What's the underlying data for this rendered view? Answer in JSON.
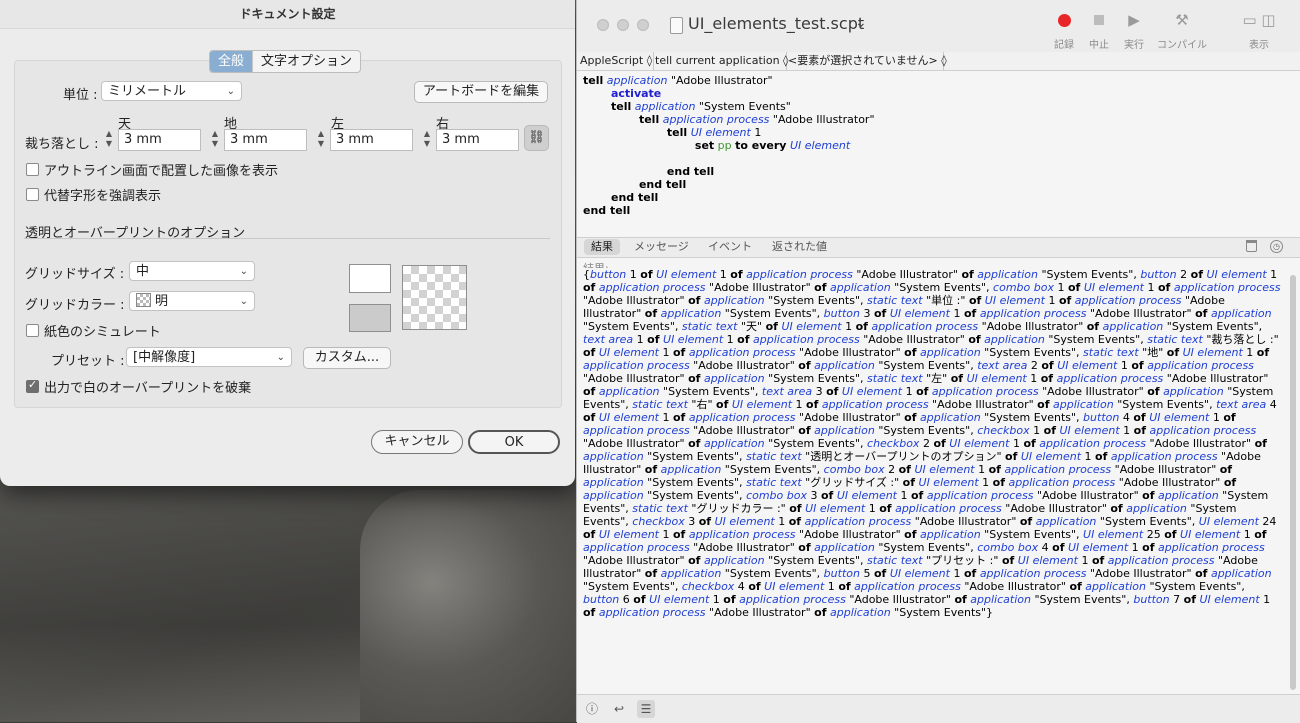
{
  "dialog": {
    "title": "ドキュメント設定",
    "tabs": [
      "全般",
      "文字オプション"
    ],
    "units_label": "単位 :",
    "units_value": "ミリメートル",
    "edit_artboards": "アートボードを編集",
    "bleed_label": "裁ち落とし :",
    "bleed": [
      {
        "head": "天",
        "value": "3 mm"
      },
      {
        "head": "地",
        "value": "3 mm"
      },
      {
        "head": "左",
        "value": "3 mm"
      },
      {
        "head": "右",
        "value": "3 mm"
      }
    ],
    "show_placed_outline": "アウトライン画面で配置した画像を表示",
    "highlight_substituted": "代替字形を強調表示",
    "transparency_title": "透明とオーバープリントのオプション",
    "grid_size_label": "グリッドサイズ :",
    "grid_size_value": "中",
    "grid_color_label": "グリッドカラー :",
    "grid_color_value": "明",
    "simulate_paper": "紙色のシミュレート",
    "preset_label": "プリセット :",
    "preset_value": "[中解像度]",
    "custom_button": "カスタム...",
    "discard_white": "出力で白のオーバープリントを破棄",
    "discard_white_checked": true,
    "cancel": "キャンセル",
    "ok": "OK"
  },
  "editor": {
    "title": "UI_elements_test.scpt",
    "toolbar": [
      "記録",
      "中止",
      "実行",
      "コンパイル",
      "表示"
    ],
    "nav": [
      "AppleScript ◊",
      "tell current application ◊",
      "<要素が選択されていません> ◊"
    ],
    "code": [
      "tell application \"Adobe Illustrator\"",
      "activate",
      "tell application \"System Events\"",
      "tell application process \"Adobe Illustrator\"",
      "tell UI element 1",
      "set pp to every UI element",
      "",
      "end tell",
      "end tell",
      "end tell",
      "end tell"
    ],
    "result_tabs": [
      "結果",
      "メッセージ",
      "イベント",
      "返された値"
    ],
    "result_head": "結果:",
    "result_text": "{button 1 of UI element 1 of application process \"Adobe Illustrator\" of application \"System Events\", button 2 of UI element 1 of application process \"Adobe Illustrator\" of application \"System Events\", combo box 1 of UI element 1 of application process \"Adobe Illustrator\" of application \"System Events\", static text \"単位 :\" of UI element 1 of application process \"Adobe Illustrator\" of application \"System Events\", button 3 of UI element 1 of application process \"Adobe Illustrator\" of application \"System Events\", static text \"天\" of UI element 1 of application process \"Adobe Illustrator\" of application \"System Events\", text area 1 of UI element 1 of application process \"Adobe Illustrator\" of application \"System Events\", static text \"裁ち落とし :\" of UI element 1 of application process \"Adobe Illustrator\" of application \"System Events\", static text \"地\" of UI element 1 of application process \"Adobe Illustrator\" of application \"System Events\", text area 2 of UI element 1 of application process \"Adobe Illustrator\" of application \"System Events\", static text \"左\" of UI element 1 of application process \"Adobe Illustrator\" of application \"System Events\", text area 3 of UI element 1 of application process \"Adobe Illustrator\" of application \"System Events\", static text \"右\" of UI element 1 of application process \"Adobe Illustrator\" of application \"System Events\", text area 4 of UI element 1 of application process \"Adobe Illustrator\" of application \"System Events\", button 4 of UI element 1 of application process \"Adobe Illustrator\" of application \"System Events\", checkbox 1 of UI element 1 of application process \"Adobe Illustrator\" of application \"System Events\", checkbox 2 of UI element 1 of application process \"Adobe Illustrator\" of application \"System Events\", static text \"透明とオーバープリントのオプション\" of UI element 1 of application process \"Adobe Illustrator\" of application \"System Events\", combo box 2 of UI element 1 of application process \"Adobe Illustrator\" of application \"System Events\", static text \"グリッドサイズ :\" of UI element 1 of application process \"Adobe Illustrator\" of application \"System Events\", combo box 3 of UI element 1 of application process \"Adobe Illustrator\" of application \"System Events\", static text \"グリッドカラー :\" of UI element 1 of application process \"Adobe Illustrator\" of application \"System Events\", checkbox 3 of UI element 1 of application process \"Adobe Illustrator\" of application \"System Events\", UI element 24 of UI element 1 of application process \"Adobe Illustrator\" of application \"System Events\", UI element 25 of UI element 1 of application process \"Adobe Illustrator\" of application \"System Events\", combo box 4 of UI element 1 of application process \"Adobe Illustrator\" of application \"System Events\", static text \"プリセット :\" of UI element 1 of application process \"Adobe Illustrator\" of application \"System Events\", button 5 of UI element 1 of application process \"Adobe Illustrator\" of application \"System Events\", checkbox 4 of UI element 1 of application process \"Adobe Illustrator\" of application \"System Events\", button 6 of UI element 1 of application process \"Adobe Illustrator\" of application \"System Events\", button 7 of UI element 1 of application process \"Adobe Illustrator\" of application \"System Events\"}"
  },
  "colors": {
    "accent_tab": "#8aaed1",
    "record": "#e8262a",
    "class_blue": "#1f3fd3",
    "var_green": "#3a9a2a"
  }
}
